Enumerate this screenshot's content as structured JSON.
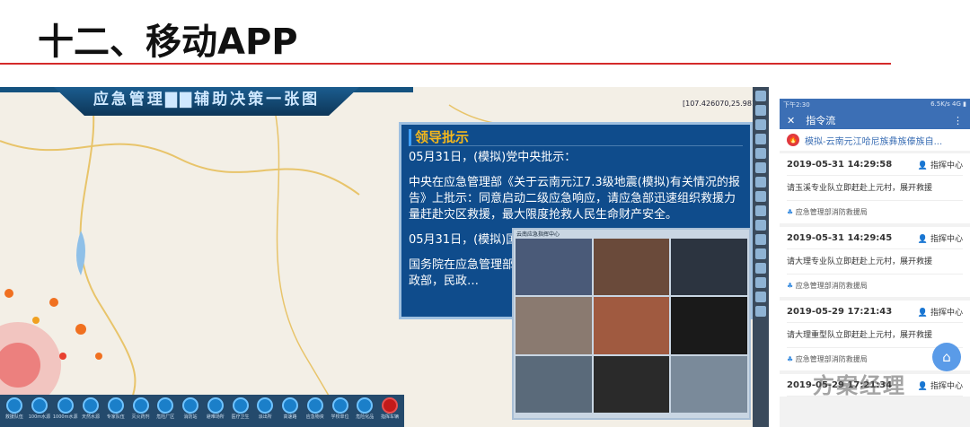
{
  "slide_title": "十二、移动APP",
  "map": {
    "banner": "应急管理▇▇辅助决策一张图",
    "coords": "[107.426070,25.981309]",
    "leader_panel": {
      "heading": "领导批示",
      "paragraphs": [
        "05月31日，(模拟)党中央批示：",
        "中央在应急管理部《关于云南元江7.3级地震(模拟)有关情况的报告》上批示：同意启动二级应急响应，请应急部迅速组织救援力量赶赴灾区救援，最大限度抢救人民生命财产安全。",
        "05月31日，(模拟)国务…",
        "国务院在应急管理部《… 批示：请应急部牵头组… 展情况，财政部，民政…"
      ]
    },
    "video_title": "云南应急指挥中心",
    "toolbar": [
      "救援队伍",
      "100m水源",
      "1000m水源",
      "天然水源",
      "专家队伍",
      "灭火药剂",
      "危险厂区",
      "消防站",
      "避难场所",
      "医疗卫生",
      "派出所",
      "高速路",
      "应急物资",
      "学校单位",
      "危险化品",
      "指挥车辆"
    ]
  },
  "phone": {
    "status_time": "下午2:30",
    "status_right": "6.5K/s 4G ▮",
    "title": "指令流",
    "event": "模拟-云南元江哈尼族彝族傣族自...",
    "cards": [
      {
        "time": "2019-05-31 14:29:58",
        "who": "指挥中心",
        "msg": "请玉溪专业队立即赶赴上元村，展开救援",
        "org": "应急管理部消防救援局"
      },
      {
        "time": "2019-05-31 14:29:45",
        "who": "指挥中心",
        "msg": "请大理专业队立即赶赴上元村，展开救援",
        "org": "应急管理部消防救援局"
      },
      {
        "time": "2019-05-29 17:21:43",
        "who": "指挥中心",
        "msg": "请大理重型队立即赶赴上元村，展开救援",
        "org": "应急管理部消防救援局"
      },
      {
        "time": "2019-05-29 17:21:34",
        "who": "指挥中心",
        "msg": "",
        "org": ""
      }
    ],
    "watermark": "方案经理"
  }
}
